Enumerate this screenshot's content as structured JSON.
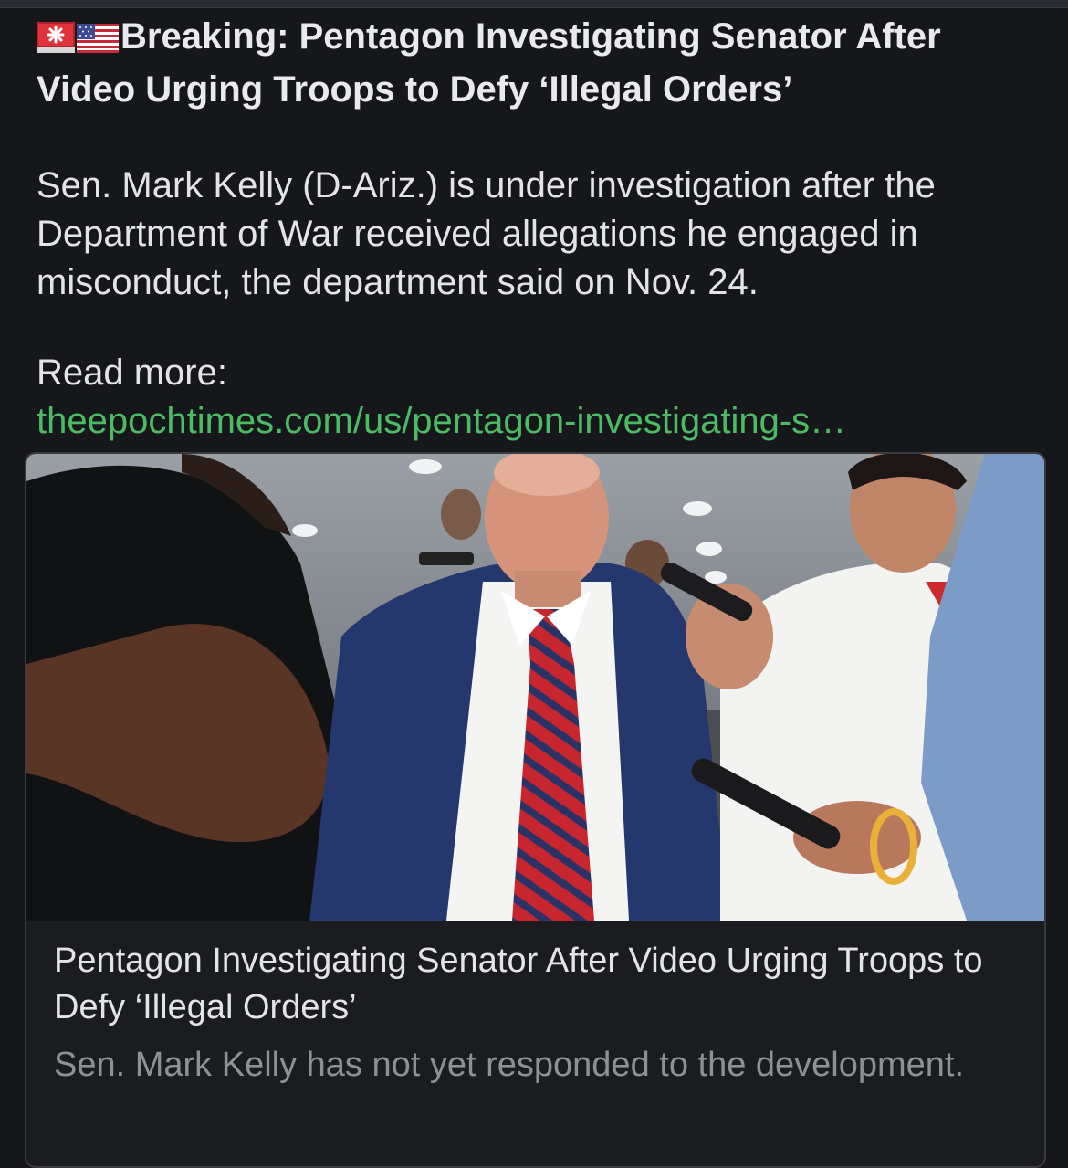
{
  "post": {
    "emoji_alert": "rotating-light-icon",
    "emoji_flag": "us-flag-icon",
    "headline": "Breaking: Pentagon Investigating Senator After Video Urging Troops to Defy ‘Illegal Orders’",
    "body": "Sen. Mark Kelly (D-Ariz.) is under investigation after the Department of War received allegations he engaged in misconduct, the department said on Nov. 24.",
    "read_more_label": "Read more:",
    "link_text": "theepochtimes.com/us/pentagon-investigating-s…",
    "link_color": "#4dbb63"
  },
  "card": {
    "title": "Pentagon Investigating Senator After Video Urging Troops to Defy ‘Illegal Orders’",
    "description": "Sen. Mark Kelly has not yet responded to the development."
  },
  "colors": {
    "background": "#16171b",
    "text": "#e6e7ea",
    "muted": "#8e9097",
    "border": "#3a3b40"
  }
}
